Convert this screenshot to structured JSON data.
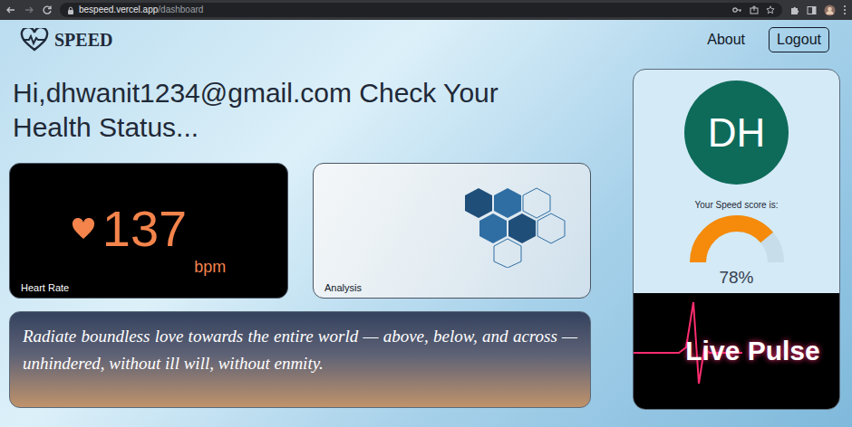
{
  "browser": {
    "url_host": "bespeed.vercel.app",
    "url_path": "/dashboard"
  },
  "nav": {
    "brand": "SPEED",
    "links": [
      "About"
    ],
    "logout": "Logout"
  },
  "greeting": "Hi,dhwanit1234@gmail.com Check Your Health Status...",
  "cards": [
    {
      "kind": "heart-rate",
      "label": "Heart Rate",
      "value": "137",
      "unit": "bpm"
    },
    {
      "kind": "image",
      "label": "Analysis"
    }
  ],
  "quote": "Radiate boundless love towards the entire world — above, below, and across — unhindered, without ill will, without enmity.",
  "profile": {
    "initials": "DH",
    "score_label": "Your Speed score is:",
    "score": "78%",
    "level": 0.78,
    "pulse_label": "Live Pulse"
  }
}
